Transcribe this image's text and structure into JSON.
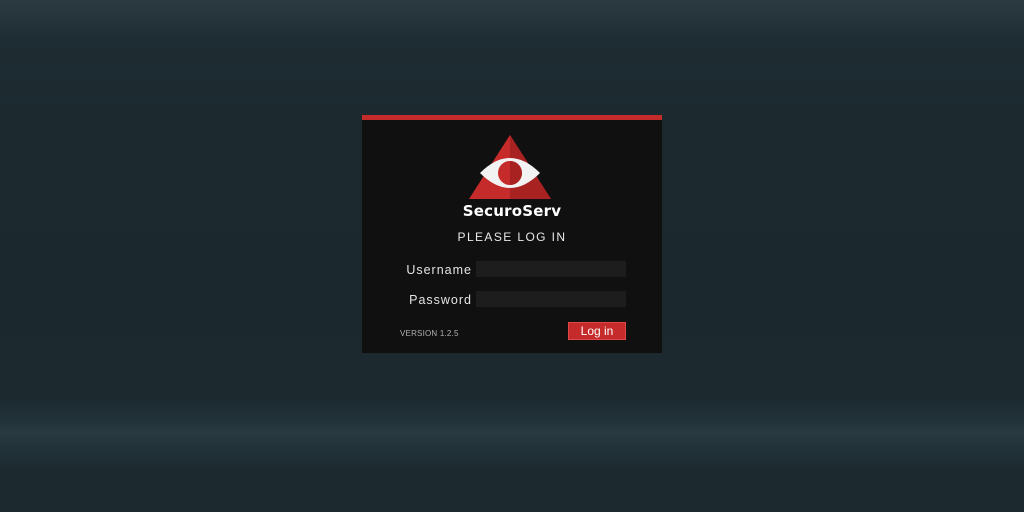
{
  "app": {
    "brand_name": "SecuroServ",
    "logo_icon": "eye-triangle-logo"
  },
  "login": {
    "heading": "PLEASE LOG IN",
    "username_label": "Username",
    "username_value": "",
    "password_label": "Password",
    "password_value": "",
    "submit_label": "Log in",
    "version": "VERSION 1.2.5"
  },
  "colors": {
    "accent": "#c62b2b",
    "panel_background": "#101010",
    "page_background": "#1c2a30",
    "input_background": "#1d1d1d"
  }
}
